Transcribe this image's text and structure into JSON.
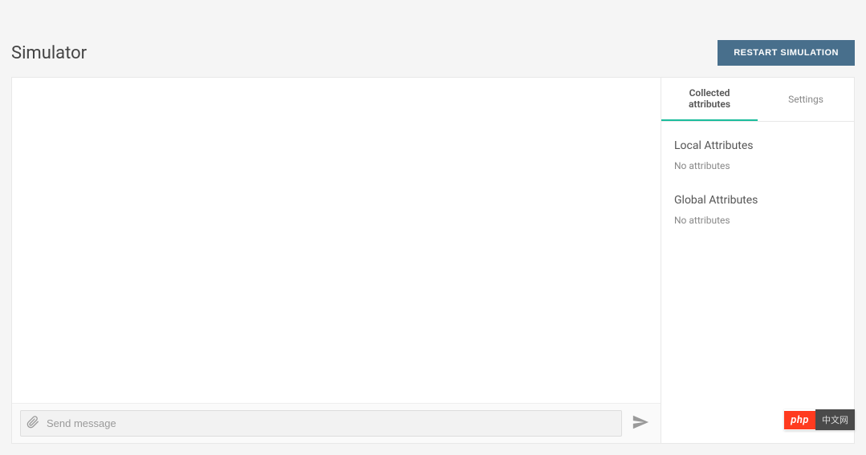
{
  "header": {
    "title": "Simulator",
    "restart_label": "RESTART SIMULATION"
  },
  "chat": {
    "input_placeholder": "Send message"
  },
  "tabs": {
    "collected_label": "Collected attributes",
    "settings_label": "Settings",
    "active": "collected"
  },
  "attributes": {
    "local_title": "Local Attributes",
    "local_empty": "No attributes",
    "global_title": "Global Attributes",
    "global_empty": "No attributes"
  },
  "badge": {
    "left": "php",
    "right_cn": "中文网"
  },
  "colors": {
    "accent": "#1abc9c",
    "primary_btn": "#486F8C",
    "badge_red": "#ff3b1f"
  }
}
